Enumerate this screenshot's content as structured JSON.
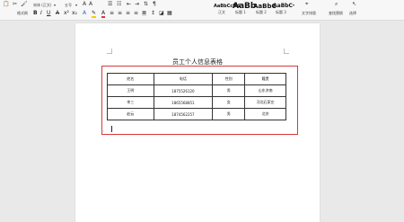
{
  "toolbar": {
    "format_painter": "格式刷",
    "font_name": "宋体 (正文)",
    "font_size": "五号",
    "styles": [
      {
        "preview": "AaBbCcDd",
        "label": "正文"
      },
      {
        "preview": "AaBb",
        "label": "标题 1"
      },
      {
        "preview": "AaBbC",
        "label": "标题 2"
      },
      {
        "preview": "AaBbC",
        "label": "标题 3"
      }
    ],
    "text_tools": "文字排版",
    "find_replace": "查找替换",
    "select": "选择"
  },
  "document": {
    "title": "员工个人信息表格",
    "table": {
      "headers": [
        "姓名",
        "电话",
        "性别",
        "籍贯"
      ],
      "rows": [
        [
          "王明",
          "1875526120",
          "男",
          "山东济南"
        ],
        [
          "李三",
          "1865568851",
          "女",
          "河北石家庄"
        ],
        [
          "赵云",
          "1874562257",
          "男",
          "北京"
        ]
      ]
    }
  }
}
